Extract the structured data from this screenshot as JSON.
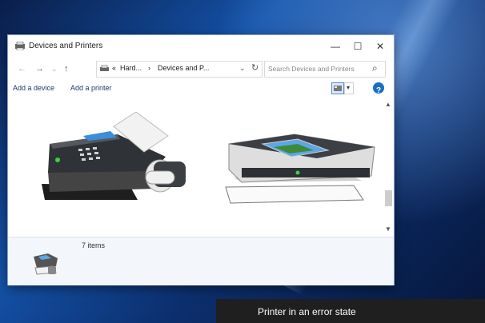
{
  "window": {
    "title": "Devices and Printers",
    "controls": {
      "minimize": "—",
      "maximize": "☐",
      "close": "✕"
    }
  },
  "nav": {
    "back": "←",
    "forward": "→",
    "history": "⌄",
    "up": "↑",
    "address": {
      "overflow": "«",
      "crumb1": "Hard...",
      "sep": "›",
      "crumb2": "Devices and P..."
    },
    "dropdown": "⌄",
    "refresh": "↻",
    "search_placeholder": "Search Devices and Printers",
    "search_icon": "⌕"
  },
  "commands": {
    "add_device": "Add a device",
    "add_printer": "Add a printer",
    "view_dropdown": "▾",
    "help": "?"
  },
  "devices": [
    {
      "name": "fax-machine",
      "icon": "fax-icon"
    },
    {
      "name": "printer",
      "icon": "printer-icon"
    }
  ],
  "details": {
    "count": "7 items"
  },
  "toast": {
    "text": "Printer in an error state"
  },
  "colors": {
    "accent": "#1e6fd9",
    "help": "#1b6ec2",
    "toast_bg": "#1f1f1f"
  }
}
